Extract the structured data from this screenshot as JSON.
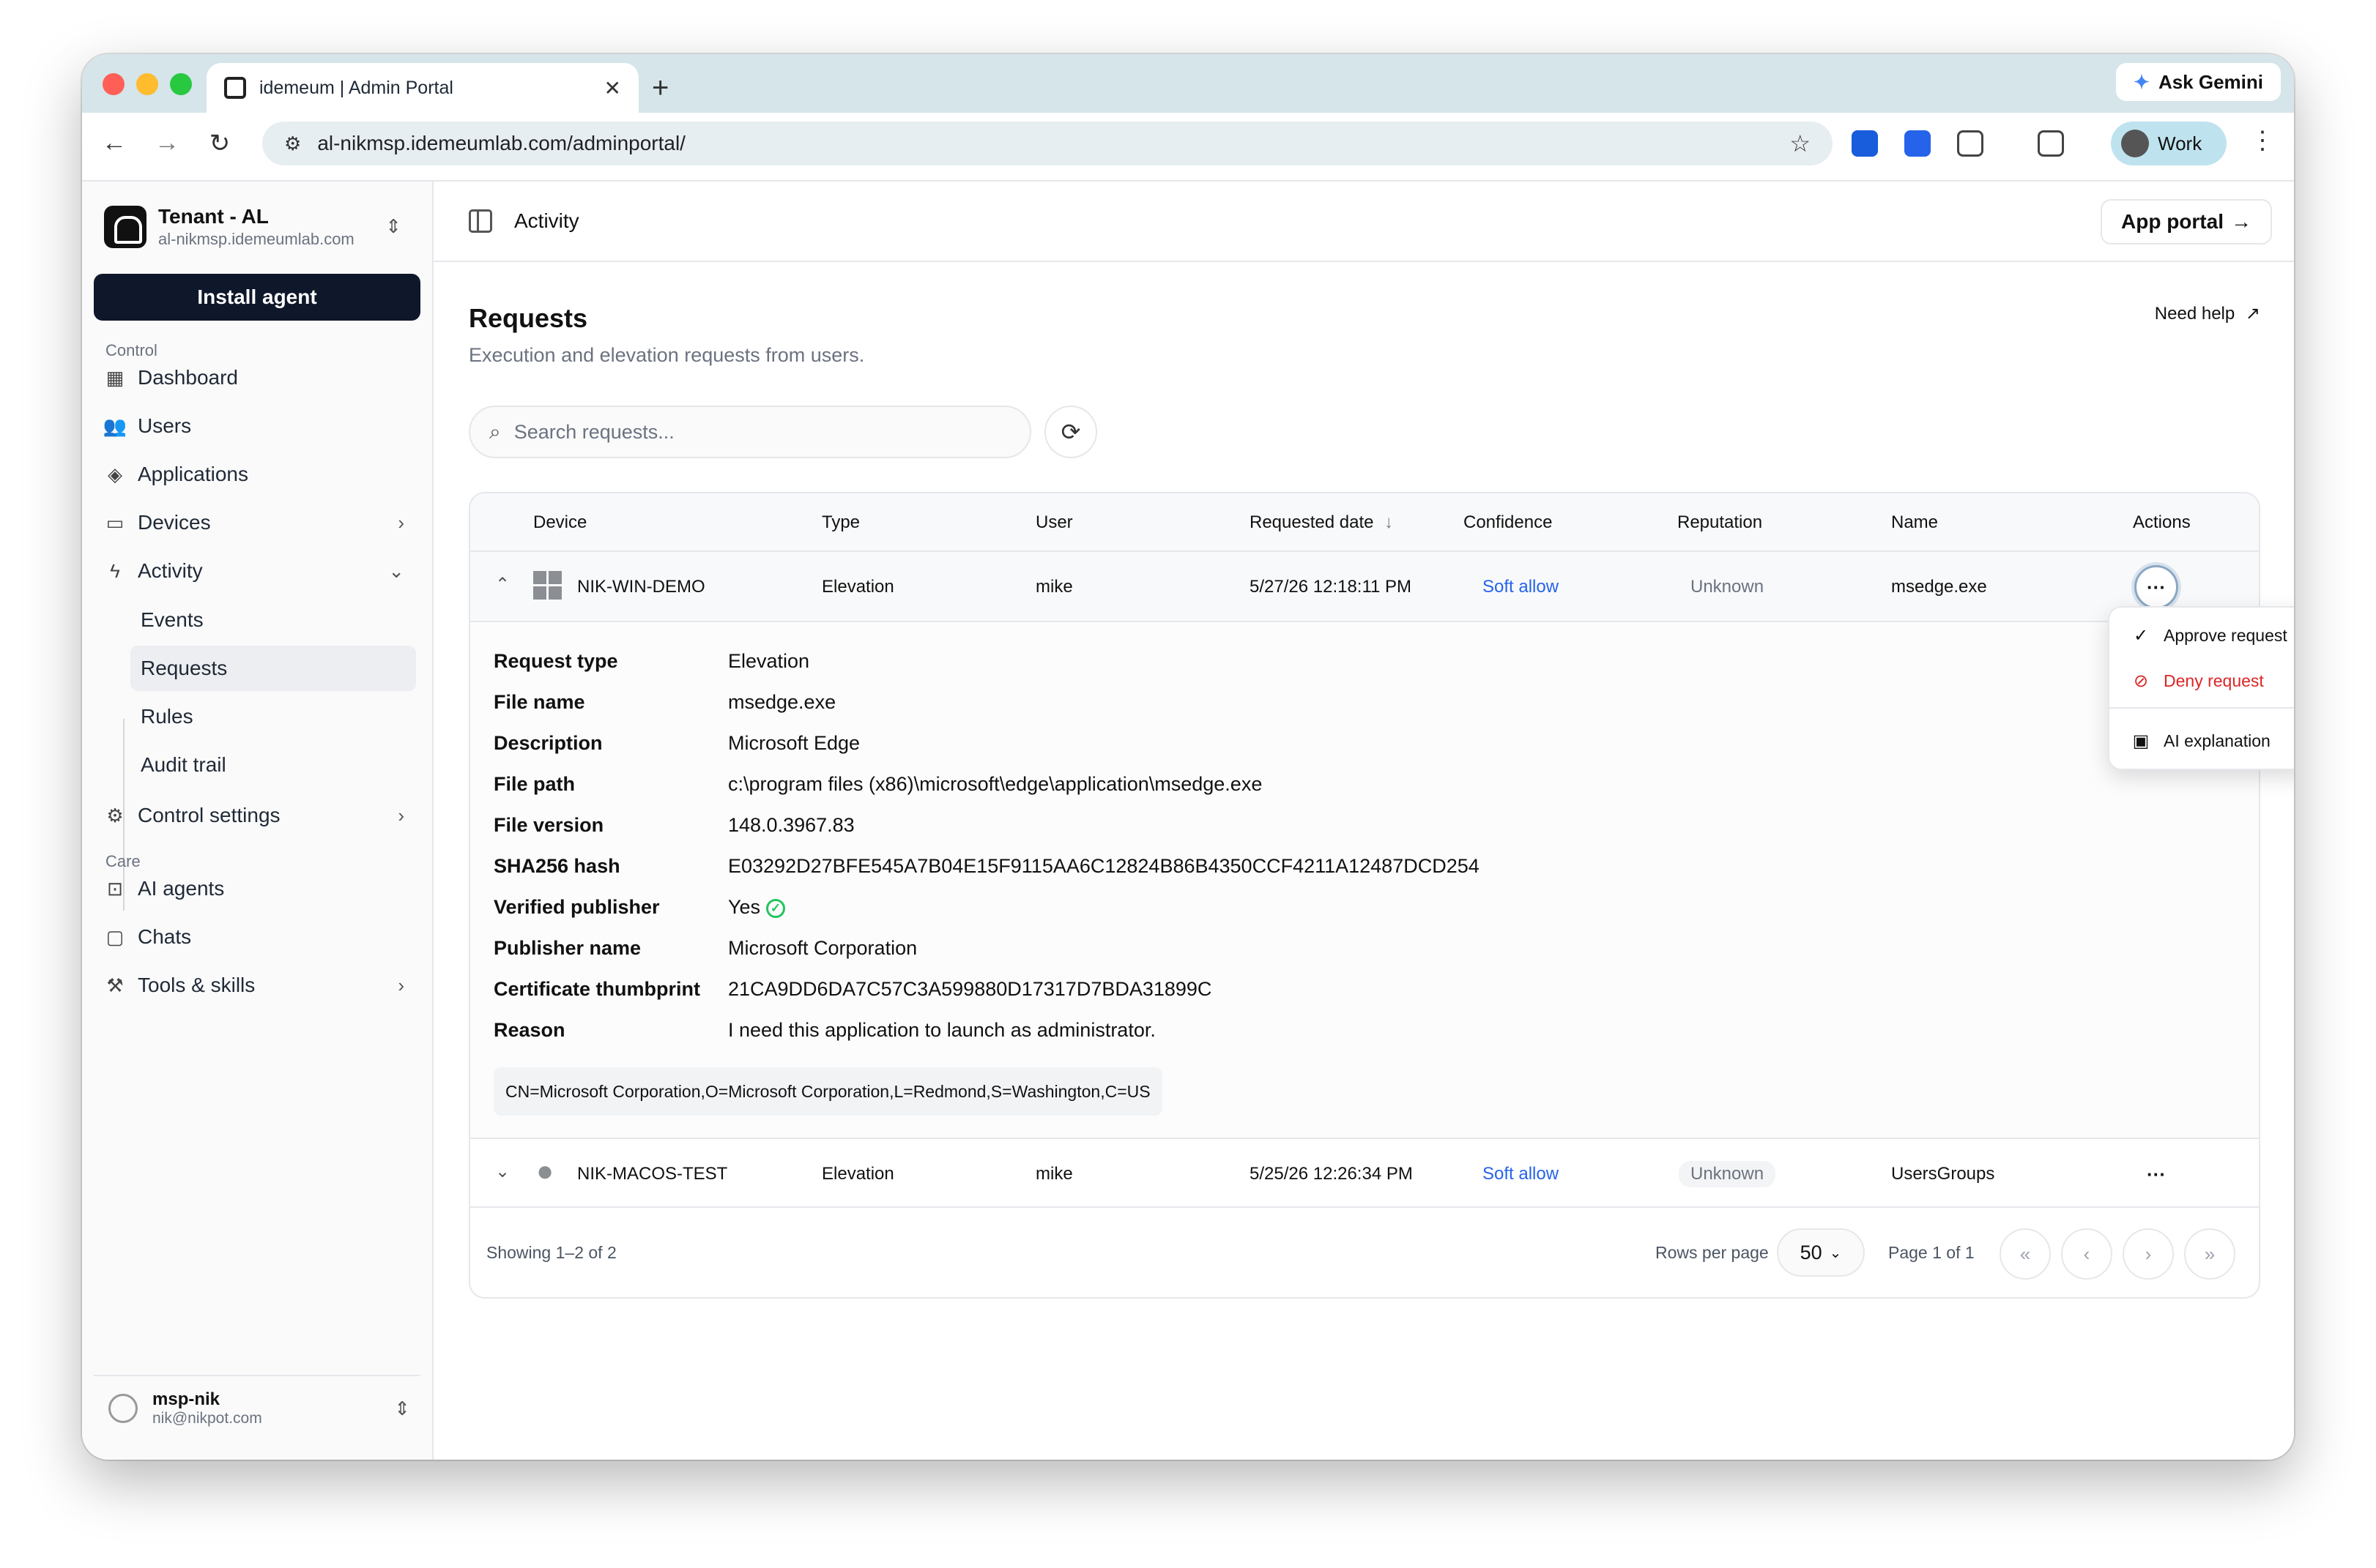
{
  "browser": {
    "tab_title": "idemeum | Admin Portal",
    "new_tab": "+",
    "close": "✕",
    "gemini": "Ask Gemini",
    "url": "al-nikmsp.idemeumlab.com/adminportal/",
    "profile": "Work"
  },
  "sidebar": {
    "tenant_name": "Tenant - AL",
    "tenant_domain": "al-nikmsp.idemeumlab.com",
    "install_agent": "Install agent",
    "section_control": "Control",
    "section_care": "Care",
    "items": [
      {
        "label": "Dashboard",
        "icon": "dashboard-icon"
      },
      {
        "label": "Users",
        "icon": "users-icon"
      },
      {
        "label": "Applications",
        "icon": "layers-icon"
      },
      {
        "label": "Devices",
        "icon": "monitor-icon"
      },
      {
        "label": "Activity",
        "icon": "activity-icon"
      },
      {
        "label": "Control settings",
        "icon": "gear-icon"
      },
      {
        "label": "AI agents",
        "icon": "robot-icon"
      },
      {
        "label": "Chats",
        "icon": "chat-icon"
      },
      {
        "label": "Tools & skills",
        "icon": "tools-icon"
      }
    ],
    "activity_sub": [
      "Events",
      "Requests",
      "Rules",
      "Audit trail"
    ],
    "user_name": "msp-nik",
    "user_email": "nik@nikpot.com"
  },
  "header": {
    "title": "Activity",
    "app_portal": "App portal"
  },
  "page": {
    "title": "Requests",
    "subtitle": "Execution and elevation requests from users.",
    "need_help": "Need help",
    "search_placeholder": "Search requests..."
  },
  "table": {
    "columns": [
      "Device",
      "Type",
      "User",
      "Requested date",
      "Confidence",
      "Reputation",
      "Name",
      "Actions"
    ],
    "rows": [
      {
        "device": "NIK-WIN-DEMO",
        "type": "Elevation",
        "user": "mike",
        "date": "5/27/26 12:18:11 PM",
        "confidence": "Soft allow",
        "reputation": "Unknown",
        "name": "msedge.exe",
        "os_icon": "windows-icon"
      },
      {
        "device": "NIK-MACOS-TEST",
        "type": "Elevation",
        "user": "mike",
        "date": "5/25/26 12:26:34 PM",
        "confidence": "Soft allow",
        "reputation": "Unknown",
        "name": "UsersGroups",
        "os_icon": "apple-icon"
      }
    ]
  },
  "detail": {
    "labels": [
      "Request type",
      "File name",
      "Description",
      "File path",
      "File version",
      "SHA256 hash",
      "Verified publisher",
      "Publisher name",
      "Certificate thumbprint",
      "Reason"
    ],
    "values": [
      "Elevation",
      "msedge.exe",
      "Microsoft Edge",
      "c:\\program files (x86)\\microsoft\\edge\\application\\msedge.exe",
      "148.0.3967.83",
      "E03292D27BFE545A7B04E15F9115AA6C12824B86B4350CCF4211A12487DCD254",
      "Yes",
      "Microsoft Corporation",
      "21CA9DD6DA7C57C3A599880D17317D7BDA31899C",
      "I need this application to launch as administrator."
    ],
    "subject": "CN=Microsoft Corporation,O=Microsoft Corporation,L=Redmond,S=Washington,C=US"
  },
  "menu": {
    "approve": "Approve request",
    "deny": "Deny request",
    "ai": "AI explanation"
  },
  "footer": {
    "showing": "Showing 1–2 of 2",
    "rows_per_page_label": "Rows per page",
    "rows_per_page": "50",
    "page_info": "Page 1 of 1"
  },
  "colors": {
    "accent_blue": "#2563eb",
    "danger": "#dc2626",
    "primary_dark": "#0f172a",
    "success": "#22c55e"
  }
}
